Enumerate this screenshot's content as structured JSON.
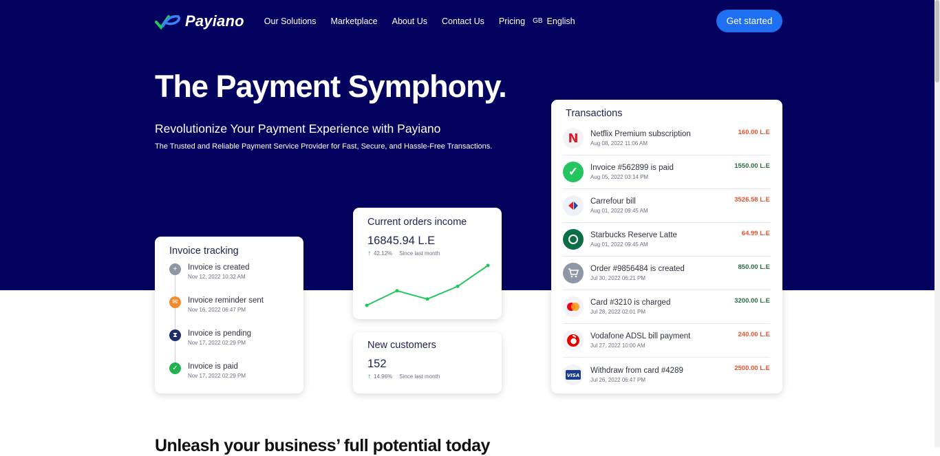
{
  "nav": {
    "brand": "Payiano",
    "links": [
      "Our Solutions",
      "Marketplace",
      "About Us",
      "Contact Us",
      "Pricing"
    ],
    "lang_flag": "GB",
    "lang_label": "English",
    "cta_label": "Get started"
  },
  "hero": {
    "headline": "The Payment Symphony.",
    "subhead": "Revolutionize Your Payment Experience with Payiano",
    "tagline": "The Trusted and Reliable Payment Service Provider for Fast, Secure, and Hassle-Free Transactions."
  },
  "invoice": {
    "title": "Invoice tracking",
    "steps": [
      {
        "label": "Invoice is created",
        "date": "Nov 12, 2022 10:32 AM",
        "icon": "plus-icon",
        "color": "#8f96a6"
      },
      {
        "label": "Invoice reminder sent",
        "date": "Nov 16, 2022 06:47 PM",
        "icon": "mail-icon",
        "color": "#f28b30"
      },
      {
        "label": "Invoice is pending",
        "date": "Nov 17, 2022 02:29 PM",
        "icon": "hourglass-icon",
        "color": "#1d2c6b"
      },
      {
        "label": "Invoice is paid",
        "date": "Nov 17, 2022 02:29 PM",
        "icon": "check-icon",
        "color": "#22b34f"
      }
    ]
  },
  "income": {
    "title": "Current orders income",
    "value": "16845.94 L.E",
    "delta": "42.12%",
    "since": "Since last month",
    "trend": [
      1,
      4,
      2.3,
      4.9,
      9.2
    ],
    "line_color": "#22c55e"
  },
  "customers": {
    "title": "New customers",
    "value": "152",
    "delta": "14.96%",
    "since": "Since last month"
  },
  "transactions": {
    "title": "Transactions",
    "items": [
      {
        "label": "Netflix Premium subscription",
        "date": "Aug 08, 2022 11:06 AM",
        "amount": "160.00 L.E",
        "dir": "out",
        "icon": "netflix-icon"
      },
      {
        "label": "Invoice #562899 is paid",
        "date": "Aug 05, 2022 03:14 PM",
        "amount": "1550.00 L.E",
        "dir": "in",
        "icon": "check-icon"
      },
      {
        "label": "Carrefour bill",
        "date": "Aug 01, 2022 09:45 AM",
        "amount": "3526.58 L.E",
        "dir": "out",
        "icon": "carrefour-icon"
      },
      {
        "label": "Starbucks Reserve Latte",
        "date": "Aug 01, 2022 09:45 AM",
        "amount": "64.99 L.E",
        "dir": "out",
        "icon": "starbucks-icon"
      },
      {
        "label": "Order #9856484 is created",
        "date": "Jul 30, 2022 06:21 PM",
        "amount": "850.00 L.E",
        "dir": "in",
        "icon": "cart-icon"
      },
      {
        "label": "Card #3210 is charged",
        "date": "Jul 28, 2022 02:01 PM",
        "amount": "3200.00 L.E",
        "dir": "in",
        "icon": "mastercard-icon"
      },
      {
        "label": "Vodafone ADSL bill payment",
        "date": "Jul 27, 2022 10:00 AM",
        "amount": "240.00 L.E",
        "dir": "out",
        "icon": "vodafone-icon"
      },
      {
        "label": "Withdraw from card #4289",
        "date": "Jul 26, 2022 06:47 PM",
        "amount": "2500.00 L.E",
        "dir": "out",
        "icon": "visa-icon"
      }
    ]
  },
  "bottom": {
    "heading": "Unleash your business’ full potential today"
  }
}
